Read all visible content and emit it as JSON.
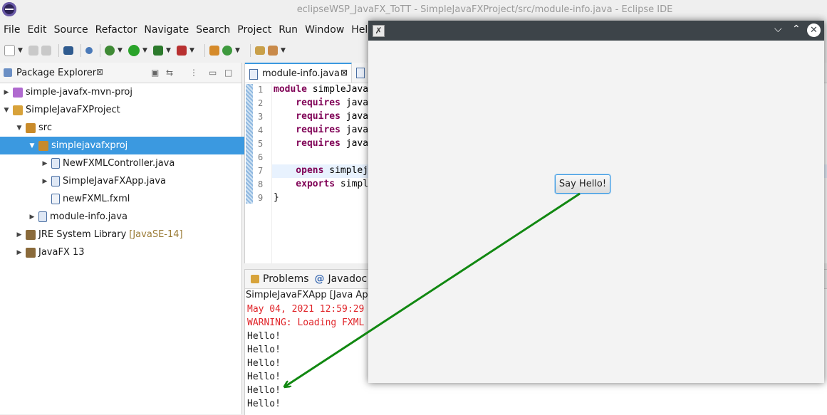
{
  "window": {
    "title": "eclipseWSP_JavaFX_ToTT - SimpleJavaFXProject/src/module-info.java - Eclipse IDE",
    "logo": "eclipse-logo-icon"
  },
  "menu": [
    "File",
    "Edit",
    "Source",
    "Refactor",
    "Navigate",
    "Search",
    "Project",
    "Run",
    "Window",
    "Help"
  ],
  "package_explorer": {
    "title": "Package Explorer",
    "close": "⊠",
    "tree": [
      {
        "label": "simple-javafx-mvn-proj",
        "decoration": "",
        "indent": 0,
        "twisty": "▶",
        "icon": "maven-project-icon",
        "selected": false
      },
      {
        "label": "SimpleJavaFXProject",
        "decoration": "",
        "indent": 0,
        "twisty": "▼",
        "icon": "java-project-icon",
        "selected": false
      },
      {
        "label": "src",
        "decoration": "",
        "indent": 1,
        "twisty": "▼",
        "icon": "source-folder-icon",
        "selected": false
      },
      {
        "label": "simplejavafxproj",
        "decoration": "",
        "indent": 2,
        "twisty": "▼",
        "icon": "package-icon",
        "selected": true
      },
      {
        "label": "NewFXMLController.java",
        "decoration": "",
        "indent": 3,
        "twisty": "▶",
        "icon": "java-file-icon",
        "selected": false
      },
      {
        "label": "SimpleJavaFXApp.java",
        "decoration": "",
        "indent": 3,
        "twisty": "▶",
        "icon": "java-file-icon",
        "selected": false
      },
      {
        "label": "newFXML.fxml",
        "decoration": "",
        "indent": 3,
        "twisty": "",
        "icon": "xml-file-icon",
        "selected": false
      },
      {
        "label": "module-info.java",
        "decoration": "",
        "indent": 2,
        "twisty": "▶",
        "icon": "java-file-icon",
        "selected": false
      },
      {
        "label": "JRE System Library",
        "decoration": "[JavaSE-14]",
        "indent": 1,
        "twisty": "▶",
        "icon": "library-icon",
        "selected": false
      },
      {
        "label": "JavaFX 13",
        "decoration": "",
        "indent": 1,
        "twisty": "▶",
        "icon": "library-icon",
        "selected": false
      }
    ]
  },
  "editor": {
    "tab_label": "module-info.java",
    "tab_close": "⊠",
    "lines": [
      {
        "n": "1",
        "kw": "module",
        "rest": " simpleJava"
      },
      {
        "n": "2",
        "kw": "    requires",
        "rest": " java"
      },
      {
        "n": "3",
        "kw": "    requires",
        "rest": " java"
      },
      {
        "n": "4",
        "kw": "    requires",
        "rest": " java"
      },
      {
        "n": "5",
        "kw": "    requires",
        "rest": " java"
      },
      {
        "n": "6",
        "kw": "",
        "rest": ""
      },
      {
        "n": "7",
        "kw": "    opens",
        "rest": " simplej"
      },
      {
        "n": "8",
        "kw": "    exports",
        "rest": " simpl"
      },
      {
        "n": "9",
        "kw": "",
        "rest": "}"
      }
    ]
  },
  "console": {
    "tabs": [
      "Problems",
      "Javadoc"
    ],
    "description": "SimpleJavaFXApp [Java Appli",
    "lines": [
      {
        "text": "May 04, 2021 12:59:29",
        "error": true
      },
      {
        "text": "WARNING: Loading FXML",
        "error": true
      },
      {
        "text": "Hello!",
        "error": false
      },
      {
        "text": "Hello!",
        "error": false
      },
      {
        "text": "Hello!",
        "error": false
      },
      {
        "text": "Hello!",
        "error": false
      },
      {
        "text": "Hello!",
        "error": false
      },
      {
        "text": "Hello!",
        "error": false
      }
    ]
  },
  "fx_window": {
    "button_label": "Say Hello!",
    "controls": {
      "minimize": "⌵",
      "maximize": "⌃",
      "close": "✕"
    }
  },
  "colors": {
    "selection": "#3b99e0",
    "keyword": "#7f0055",
    "console_error": "#e0252a",
    "annotation_arrow": "#118811"
  }
}
